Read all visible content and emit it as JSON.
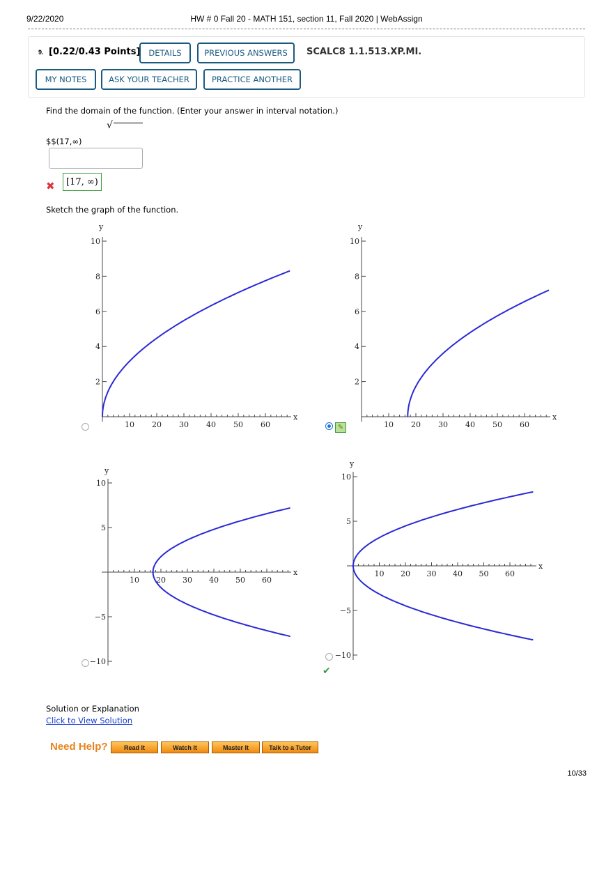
{
  "header": {
    "date": "9/22/2020",
    "title": "HW # 0 Fall 20 - MATH 151, section 11, Fall 2020 | WebAssign"
  },
  "question": {
    "number": "9.",
    "points": "[0.22/0.43 Points]",
    "code": "SCALC8 1.1.513.XP.MI.",
    "buttons": {
      "details": "DETAILS",
      "previous_answers": "PREVIOUS ANSWERS",
      "my_notes": "MY NOTES",
      "ask_teacher": "ASK YOUR TEACHER",
      "practice_another": "PRACTICE ANOTHER"
    }
  },
  "part1": {
    "prompt": "Find the domain of the function. (Enter your answer in interval notation.)",
    "radical": "√",
    "previous_answer": "$$(17,∞)",
    "input_value": "",
    "status": "incorrect",
    "correct_answer": "[17, ∞)"
  },
  "part2": {
    "prompt": "Sketch the graph of the function.",
    "selected_option": 2,
    "correct_option": 4
  },
  "chart_data": [
    {
      "type": "line",
      "xlabel": "x",
      "ylabel": "y",
      "xlim": [
        0,
        70
      ],
      "ylim": [
        0,
        10
      ],
      "xticks": [
        10,
        20,
        30,
        40,
        50,
        60
      ],
      "yticks": [
        2,
        4,
        6,
        8,
        10
      ],
      "series": [
        {
          "function": "y = sqrt(x)",
          "x_range": [
            0,
            69
          ]
        }
      ]
    },
    {
      "type": "line",
      "xlabel": "x",
      "ylabel": "y",
      "xlim": [
        0,
        70
      ],
      "ylim": [
        0,
        10
      ],
      "xticks": [
        10,
        20,
        30,
        40,
        50,
        60
      ],
      "yticks": [
        2,
        4,
        6,
        8,
        10
      ],
      "series": [
        {
          "function": "y = sqrt(x - 17)",
          "x_range": [
            17,
            69
          ]
        }
      ]
    },
    {
      "type": "line",
      "xlabel": "x",
      "ylabel": "y",
      "xlim": [
        0,
        70
      ],
      "ylim": [
        -10,
        10
      ],
      "xticks": [
        10,
        20,
        30,
        40,
        50,
        60
      ],
      "yticks": [
        -10,
        -5,
        5,
        10
      ],
      "series": [
        {
          "function": "x = y^2 + 17",
          "y_range": [
            -7.2,
            7.2
          ]
        }
      ]
    },
    {
      "type": "line",
      "xlabel": "x",
      "ylabel": "y",
      "xlim": [
        0,
        70
      ],
      "ylim": [
        -10,
        10
      ],
      "xticks": [
        10,
        20,
        30,
        40,
        50,
        60
      ],
      "yticks": [
        -10,
        -5,
        5,
        10
      ],
      "series": [
        {
          "function": "x = y^2",
          "y_range": [
            -8.3,
            8.3
          ]
        }
      ]
    }
  ],
  "solution": {
    "label": "Solution or Explanation",
    "link": "Click to View Solution"
  },
  "help": {
    "title": "Need Help?",
    "buttons": [
      "Read It",
      "Watch It",
      "Master It",
      "Talk to a Tutor"
    ]
  },
  "footer": {
    "page": "10/33"
  }
}
